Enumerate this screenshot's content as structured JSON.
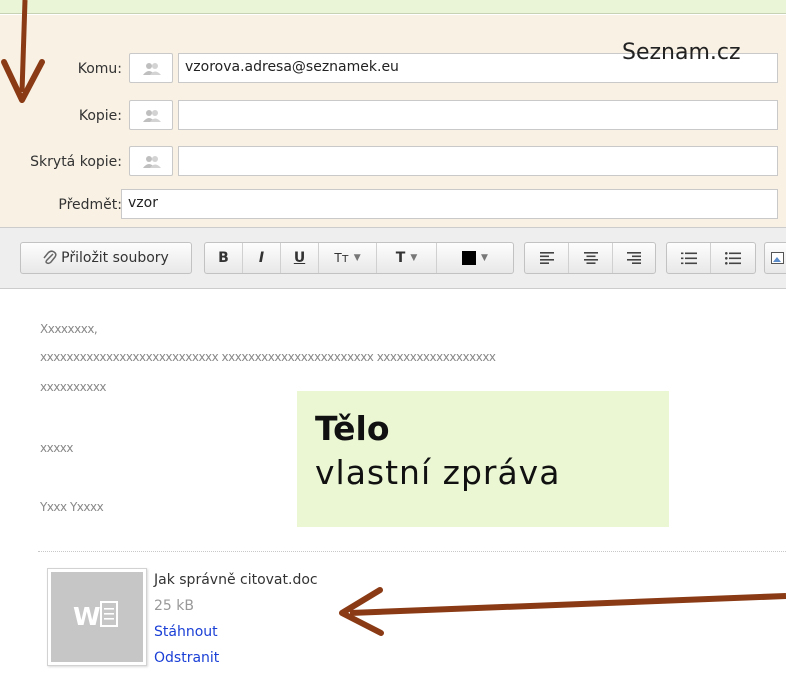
{
  "service": {
    "name": "Seznam.cz"
  },
  "header": {
    "to": {
      "label": "Komu:",
      "value": "vzorova.adresa@seznamek.eu"
    },
    "cc": {
      "label": "Kopie:",
      "value": ""
    },
    "bcc": {
      "label": "Skrytá kopie:",
      "value": ""
    },
    "subject": {
      "label": "Předmět:",
      "value": "vzor"
    }
  },
  "toolbar": {
    "attach_label": "Přiložit soubory",
    "bold": "B",
    "italic": "I",
    "underline": "U",
    "font_size": "Tт",
    "font_style": "T"
  },
  "message": {
    "lines": [
      "Xxxxxxxx,",
      "xxxxxxxxxxxxxxxxxxxxxxxxxxx xxxxxxxxxxxxxxxxxxxxxxx xxxxxxxxxxxxxxxxxx",
      "xxxxxxxxxx",
      "xxxxx",
      "Yxxx Yxxxx"
    ]
  },
  "callout": {
    "title": "Tělo",
    "subtitle": "vlastní  zpráva"
  },
  "attachment": {
    "filename": "Jak správně citovat.doc",
    "size": "25 kB",
    "download_label": "Stáhnout",
    "remove_label": "Odstranit",
    "icon": "word-document-icon"
  },
  "colors": {
    "header_bg": "#f8f1e4",
    "top_band": "#eaf4d6",
    "callout_bg": "#ebf7d3",
    "arrow": "#8a3a14",
    "link": "#1a3fd6"
  }
}
